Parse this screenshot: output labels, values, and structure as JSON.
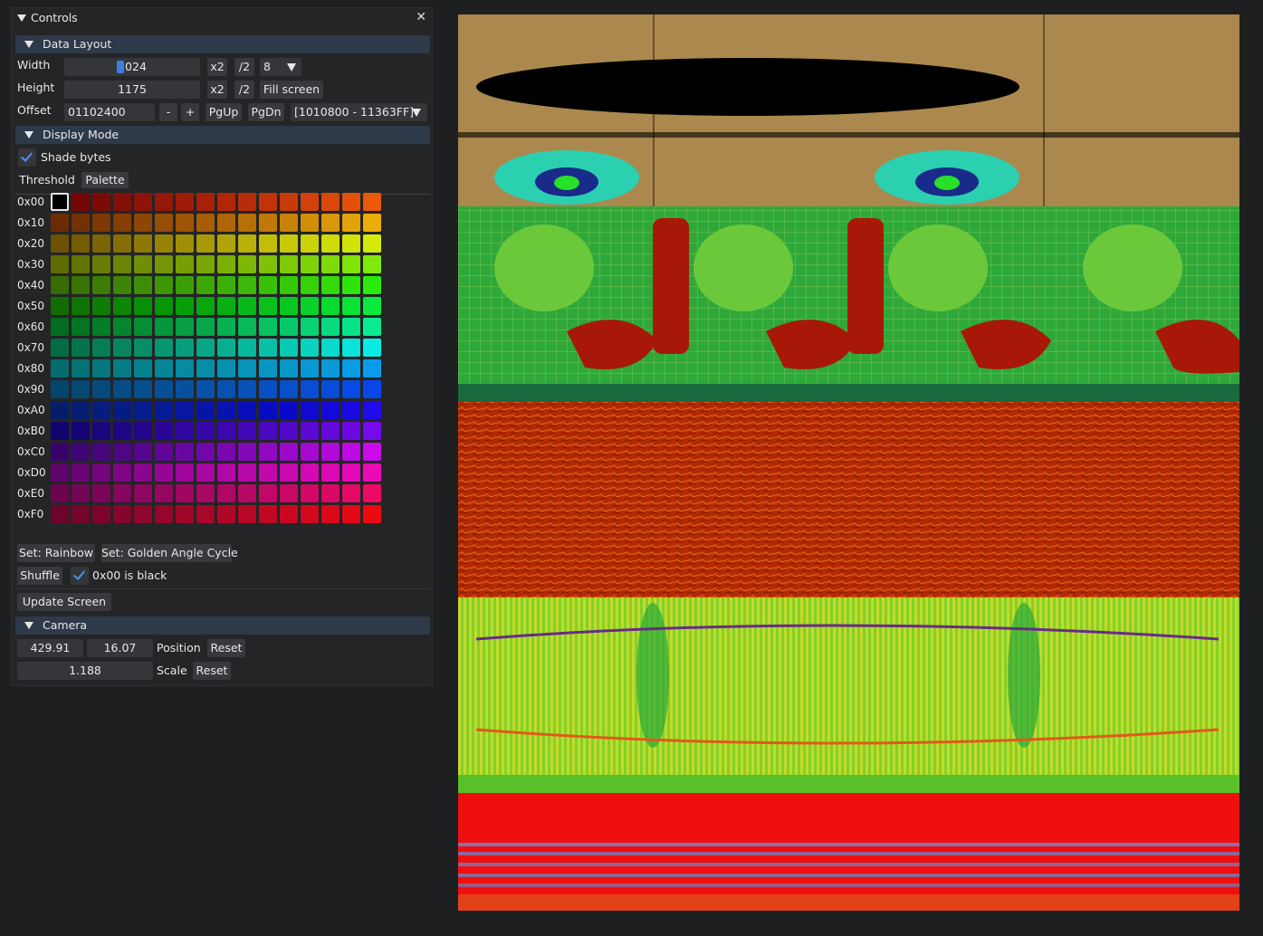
{
  "window": {
    "title": "Controls"
  },
  "data_layout": {
    "header": "Data Layout",
    "width_label": "Width",
    "width_value": "1024",
    "x2_label": "x2",
    "half_label": "/2",
    "bpp_value": "8",
    "height_label": "Height",
    "height_value": "1175",
    "fill_screen_label": "Fill screen",
    "offset_label": "Offset",
    "offset_value": "01102400",
    "minus_label": "-",
    "plus_label": "+",
    "pgup_label": "PgUp",
    "pgdn_label": "PgDn",
    "range_value": "[1010800 - 11363FF]"
  },
  "display_mode": {
    "header": "Display Mode",
    "shade_bytes_label": "Shade bytes",
    "shade_bytes_checked": true,
    "tabs": [
      "Threshold",
      "Palette"
    ],
    "active_tab": "Palette",
    "row_labels": [
      "0x00",
      "0x10",
      "0x20",
      "0x30",
      "0x40",
      "0x50",
      "0x60",
      "0x70",
      "0x80",
      "0x90",
      "0xA0",
      "0xB0",
      "0xC0",
      "0xD0",
      "0xE0",
      "0xF0"
    ],
    "set_rainbow_label": "Set: Rainbow",
    "set_golden_label": "Set: Golden Angle Cycle",
    "shuffle_label": "Shuffle",
    "black_label": "0x00 is black",
    "black_checked": true
  },
  "update_screen_label": "Update Screen",
  "camera": {
    "header": "Camera",
    "pos_x": "429.91",
    "pos_y": "16.07",
    "position_label": "Position",
    "reset_label": "Reset",
    "scale_value": "1.188",
    "scale_label": "Scale"
  },
  "colors": {
    "panel_bg": "#242526",
    "header_bg": "#2e3949",
    "accent": "#3d7fe0",
    "palette_start_hue": 0,
    "palette_end_hue": 360
  }
}
